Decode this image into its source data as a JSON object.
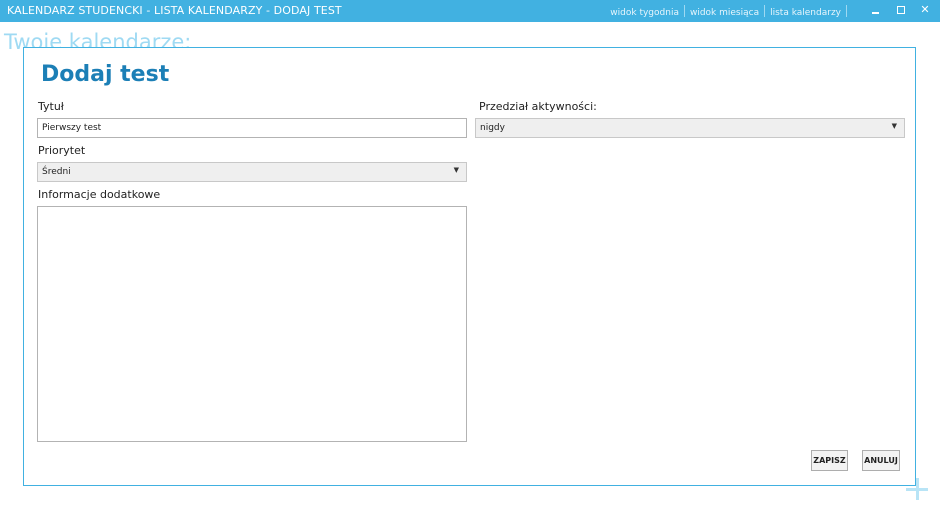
{
  "window": {
    "title": "KALENDARZ STUDENCKI - LISTA KALENDARZY - DODAJ TEST",
    "nav": [
      "widok tygodnia",
      "widok miesiąca",
      "lista kalendarzy"
    ],
    "close_glyph": "✕",
    "accent_color": "#41b1e1"
  },
  "background": {
    "heading": "Twoje kalendarze:",
    "add_icon": "plus-icon"
  },
  "dialog": {
    "title": "Dodaj test",
    "title_label": "Tytuł",
    "title_value": "Pierwszy test",
    "priority_label": "Priorytet",
    "priority_value": "Średni",
    "info_label": "Informacje dodatkowe",
    "info_value": "",
    "range_label": "Przedział aktywności:",
    "range_value": "nigdy",
    "dropdown_glyph": "▼",
    "save_label": "ZAPISZ",
    "cancel_label": "ANULUJ"
  }
}
